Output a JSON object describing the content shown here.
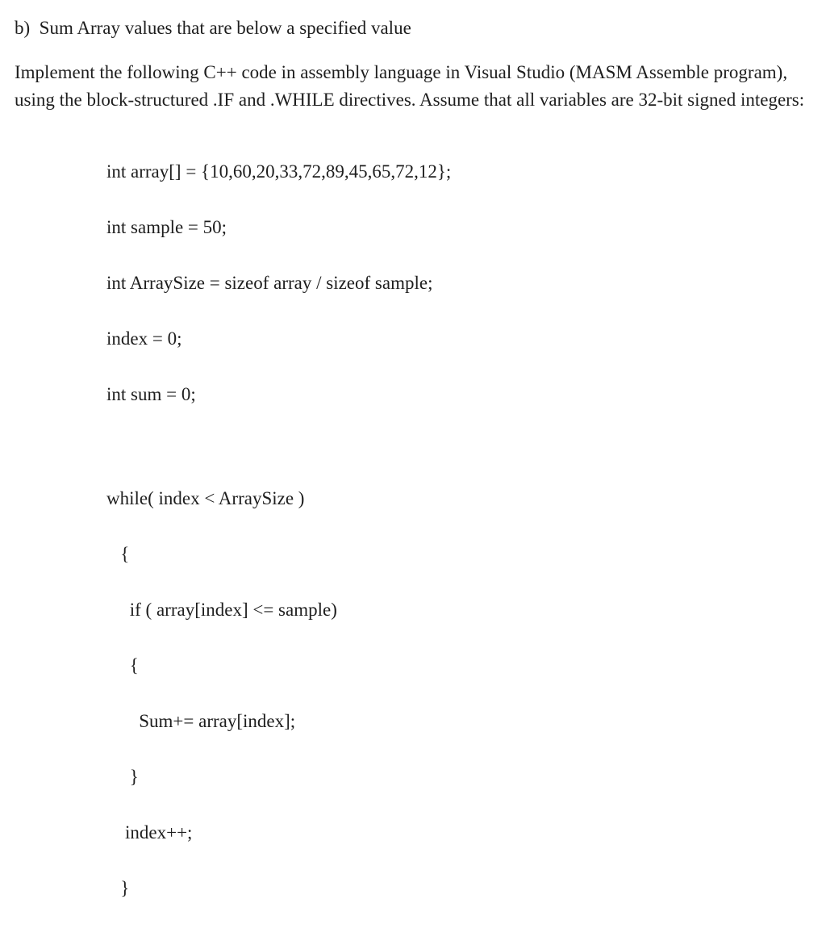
{
  "header": {
    "label": "b)",
    "title": "Sum Array values that are below a specified value"
  },
  "paragraph": "Implement the following C++ code in assembly language in Visual Studio (MASM Assemble program), using the block-structured .IF and .WHILE directives. Assume that all variables are 32-bit signed integers:",
  "code": {
    "l1": "int array[] = {10,60,20,33,72,89,45,65,72,12};",
    "l2": "int sample = 50;",
    "l3": "int ArraySize = sizeof array / sizeof sample;",
    "l4": "index = 0;",
    "l5": "int sum = 0;",
    "l6": "while( index < ArraySize )",
    "l7": "   {",
    "l8": "     if ( array[index] <= sample)",
    "l9": "     {",
    "l10": "       Sum+= array[index];",
    "l11": "     }",
    "l12": "    index++;",
    "l13": "   }"
  }
}
